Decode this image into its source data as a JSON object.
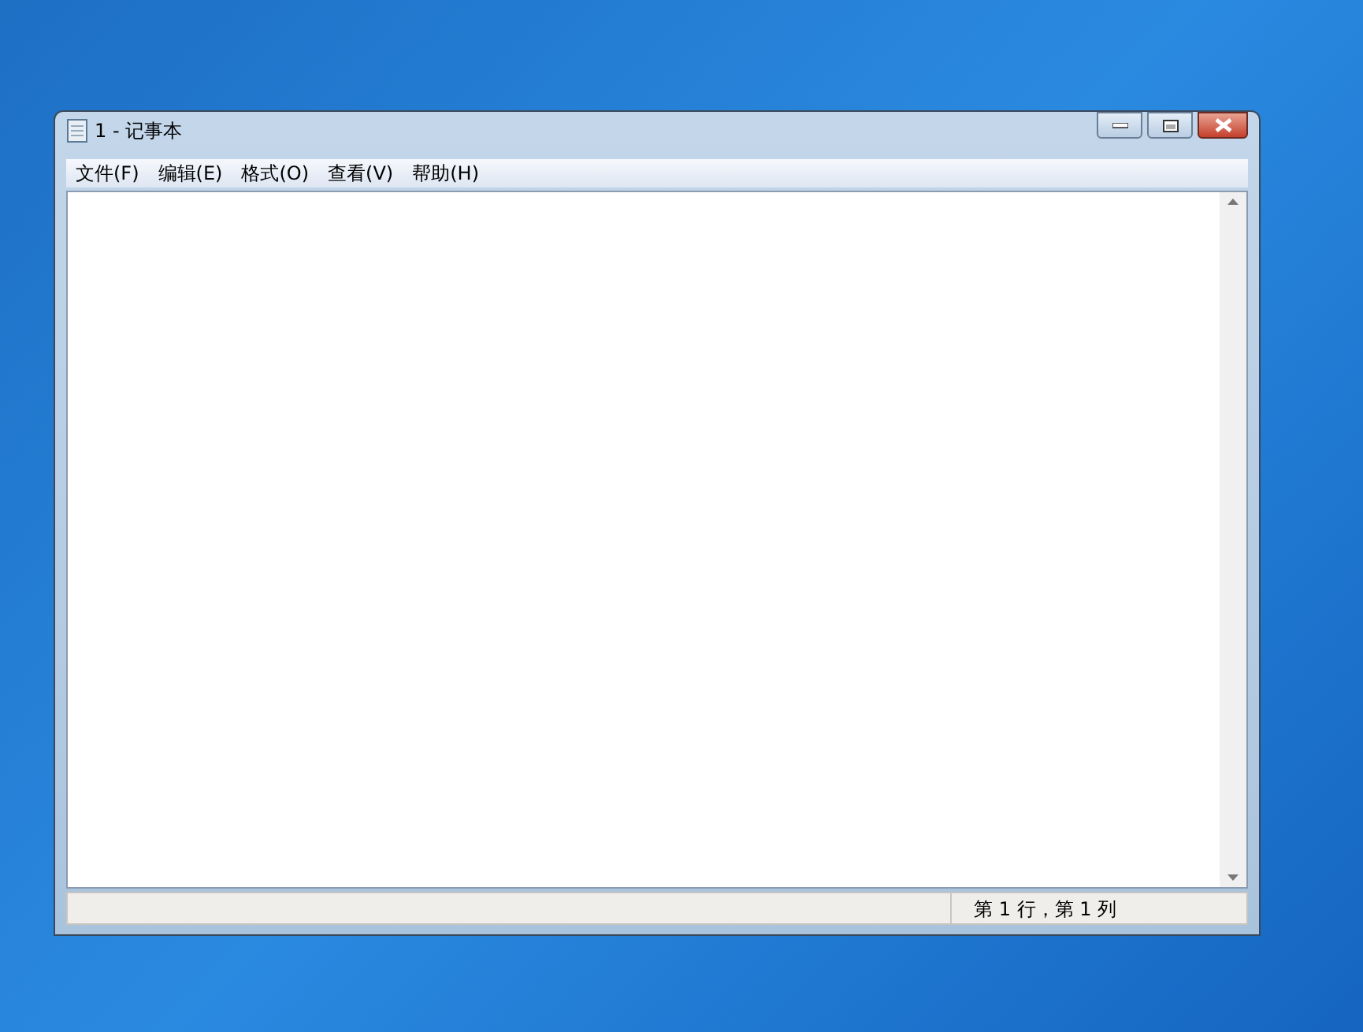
{
  "window": {
    "title": "1 - 记事本"
  },
  "menu": [
    {
      "label": "文件(F)"
    },
    {
      "label": "编辑(E)"
    },
    {
      "label": "格式(O)"
    },
    {
      "label": "查看(V)"
    },
    {
      "label": "帮助(H)"
    }
  ],
  "status_bar": {
    "position": "第 1 行，第 1 列"
  }
}
